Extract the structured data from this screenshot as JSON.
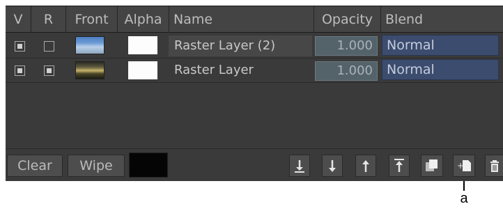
{
  "header": {
    "v": "V",
    "r": "R",
    "front": "Front",
    "alpha": "Alpha",
    "name": "Name",
    "opacity": "Opacity",
    "blend": "Blend"
  },
  "layers": [
    {
      "name": "Raster Layer (2)",
      "v_checked": true,
      "r_checked": false,
      "thumbnail": "sky",
      "opacity": "1.000",
      "blend": "Normal"
    },
    {
      "name": "Raster Layer",
      "v_checked": true,
      "r_checked": true,
      "thumbnail": "sunset",
      "opacity": "1.000",
      "blend": "Normal"
    }
  ],
  "footer": {
    "clear_label": "Clear",
    "wipe_label": "Wipe",
    "swatch_color": "#050505",
    "icons": [
      "move-to-bottom-icon",
      "move-down-icon",
      "move-up-icon",
      "move-to-top-icon",
      "duplicate-layer-icon",
      "add-layer-icon",
      "delete-layer-icon"
    ]
  },
  "callout": {
    "label": "a"
  }
}
